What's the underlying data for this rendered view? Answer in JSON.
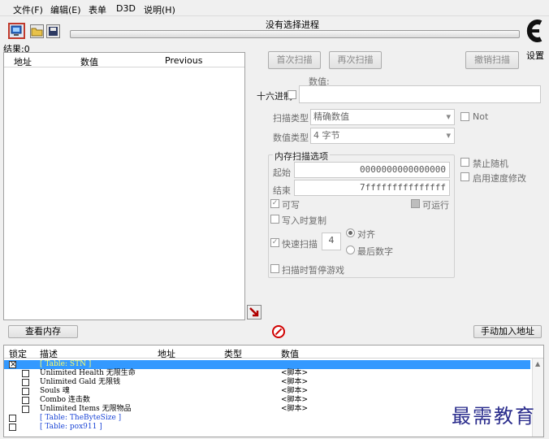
{
  "menu": [
    "文件(F)",
    "编辑(E)",
    "表单",
    "D3D",
    "说明(H)"
  ],
  "process_title": "没有选择进程",
  "settings_label": "设置",
  "result_label": "结果:0",
  "results_columns": [
    "地址",
    "数值",
    "Previous"
  ],
  "buttons": {
    "first_scan": "首次扫描",
    "next_scan": "再次扫描",
    "undo_scan": "撤销扫描",
    "view_memory": "查看内存",
    "add_manual": "手动加入地址"
  },
  "value_label": "数值:",
  "hex_label": "十六进制",
  "scan_type_label": "扫描类型",
  "scan_type_value": "精确数值",
  "value_type_label": "数值类型",
  "value_type_value": "4 字节",
  "not_label": "Not",
  "memory_options": {
    "title": "内存扫描选项",
    "start_label": "起始",
    "start_value": "0000000000000000",
    "end_label": "结束",
    "end_value": "7fffffffffffffff",
    "writable": "可写",
    "executable": "可运行",
    "copy_on_write": "写入时复制",
    "fast_scan": "快速扫描",
    "fast_scan_value": "4",
    "align": "对齐",
    "last_digit": "最后数字",
    "pause_game": "扫描时暂停游戏"
  },
  "disable_random": "禁止随机",
  "speed_hack": "启用速度修改",
  "cheat_columns": [
    "锁定",
    "描述",
    "地址",
    "类型",
    "数值"
  ],
  "cheat_rows": [
    {
      "desc": "[ Table: STN ]",
      "addr": "",
      "type": "",
      "value": "",
      "selected": true,
      "header": true
    },
    {
      "desc": "Unlimited Health 无限生命",
      "value": "<脚本>"
    },
    {
      "desc": "Unlimited Gald 无限钱",
      "value": "<脚本>"
    },
    {
      "desc": "Souls 魂",
      "value": "<脚本>"
    },
    {
      "desc": "Combo 连击数",
      "value": "<脚本>"
    },
    {
      "desc": "Unlimited Items 无限物品",
      "value": "<脚本>"
    },
    {
      "desc": "[ Table: TheByteSize ]",
      "value": "",
      "header": true
    },
    {
      "desc": "[ Table: pox911 ]",
      "value": "",
      "header": true
    }
  ],
  "watermark": "最需教育",
  "colors": {
    "selected_row": "#3399ff",
    "table_header_text": "#1b45d6",
    "cursor_red": "#d00000"
  }
}
